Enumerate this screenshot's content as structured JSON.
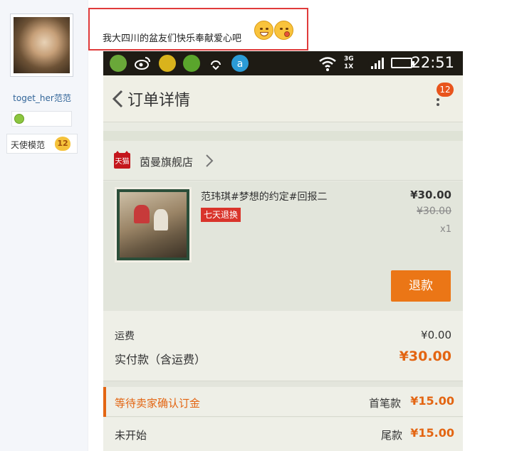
{
  "profile": {
    "username": "toget_her范范",
    "title": "天使模范",
    "title_badge": "12"
  },
  "post": {
    "text": "我大四川的盆友们快乐奉献爱心吧",
    "emojis": [
      "grin-emoji",
      "tongue-emoji"
    ]
  },
  "phone": {
    "statusbar": {
      "time": "22:51",
      "net_top": "3G",
      "net_bottom": "1X",
      "icons": [
        "app-icon-1",
        "weibo-icon",
        "music-icon",
        "wandoujia-icon",
        "sync-icon",
        "a-app-icon",
        "wifi-icon",
        "signal-icon",
        "battery-icon"
      ]
    },
    "appbar": {
      "title": "订单详情",
      "badge": "12"
    },
    "store": {
      "icon_label": "天猫",
      "name": "茵曼旗舰店"
    },
    "product": {
      "name": "范玮琪#梦想的约定#回报二",
      "tag": "七天退换",
      "price": "¥30.00",
      "original_price": "¥30.00",
      "quantity": "x1",
      "refund_button": "退款"
    },
    "totals": {
      "shipping_label": "运费",
      "shipping_value": "¥0.00",
      "paid_label": "实付款（含运费）",
      "paid_value": "¥30.00"
    },
    "payments": [
      {
        "status": "等待卖家确认订金",
        "label": "首笔款",
        "amount": "¥15.00"
      },
      {
        "status": "未开始",
        "label": "尾款",
        "amount": "¥15.00"
      }
    ]
  },
  "colors": {
    "accent": "#e36512",
    "highlight_border": "#e03b3b",
    "tag_red": "#d9342b"
  }
}
